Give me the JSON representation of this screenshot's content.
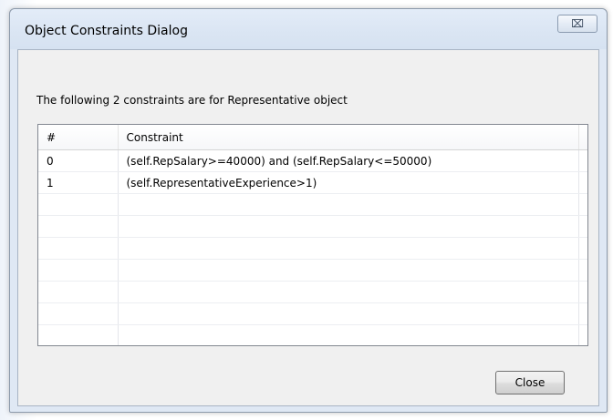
{
  "dialog": {
    "title": "Object Constraints Dialog",
    "close_glyph": "⌧",
    "summary": "The following 2 constraints are for Representative object",
    "close_button_label": "Close"
  },
  "table": {
    "headers": [
      "#",
      "Constraint"
    ],
    "rows": [
      {
        "index": "0",
        "constraint": "(self.RepSalary>=40000) and (self.RepSalary<=50000)"
      },
      {
        "index": "1",
        "constraint": "(self.RepresentativeExperience>1)"
      }
    ],
    "empty_rows": 8
  }
}
